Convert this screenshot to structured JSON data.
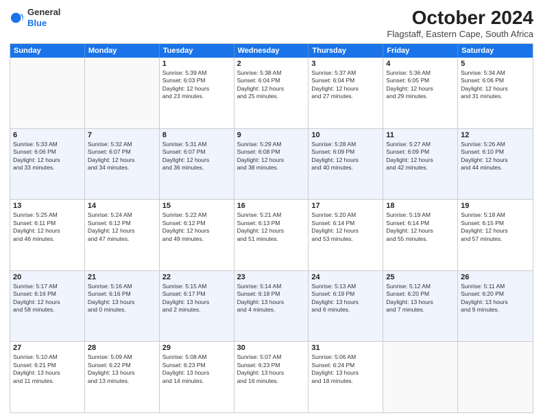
{
  "logo": {
    "line1": "General",
    "line2": "Blue"
  },
  "title": "October 2024",
  "subtitle": "Flagstaff, Eastern Cape, South Africa",
  "days": [
    "Sunday",
    "Monday",
    "Tuesday",
    "Wednesday",
    "Thursday",
    "Friday",
    "Saturday"
  ],
  "weeks": [
    [
      {
        "day": "",
        "content": ""
      },
      {
        "day": "",
        "content": ""
      },
      {
        "day": "1",
        "content": "Sunrise: 5:39 AM\nSunset: 6:03 PM\nDaylight: 12 hours\nand 23 minutes."
      },
      {
        "day": "2",
        "content": "Sunrise: 5:38 AM\nSunset: 6:04 PM\nDaylight: 12 hours\nand 25 minutes."
      },
      {
        "day": "3",
        "content": "Sunrise: 5:37 AM\nSunset: 6:04 PM\nDaylight: 12 hours\nand 27 minutes."
      },
      {
        "day": "4",
        "content": "Sunrise: 5:36 AM\nSunset: 6:05 PM\nDaylight: 12 hours\nand 29 minutes."
      },
      {
        "day": "5",
        "content": "Sunrise: 5:34 AM\nSunset: 6:06 PM\nDaylight: 12 hours\nand 31 minutes."
      }
    ],
    [
      {
        "day": "6",
        "content": "Sunrise: 5:33 AM\nSunset: 6:06 PM\nDaylight: 12 hours\nand 33 minutes."
      },
      {
        "day": "7",
        "content": "Sunrise: 5:32 AM\nSunset: 6:07 PM\nDaylight: 12 hours\nand 34 minutes."
      },
      {
        "day": "8",
        "content": "Sunrise: 5:31 AM\nSunset: 6:07 PM\nDaylight: 12 hours\nand 36 minutes."
      },
      {
        "day": "9",
        "content": "Sunrise: 5:29 AM\nSunset: 6:08 PM\nDaylight: 12 hours\nand 38 minutes."
      },
      {
        "day": "10",
        "content": "Sunrise: 5:28 AM\nSunset: 6:09 PM\nDaylight: 12 hours\nand 40 minutes."
      },
      {
        "day": "11",
        "content": "Sunrise: 5:27 AM\nSunset: 6:09 PM\nDaylight: 12 hours\nand 42 minutes."
      },
      {
        "day": "12",
        "content": "Sunrise: 5:26 AM\nSunset: 6:10 PM\nDaylight: 12 hours\nand 44 minutes."
      }
    ],
    [
      {
        "day": "13",
        "content": "Sunrise: 5:25 AM\nSunset: 6:11 PM\nDaylight: 12 hours\nand 46 minutes."
      },
      {
        "day": "14",
        "content": "Sunrise: 5:24 AM\nSunset: 6:12 PM\nDaylight: 12 hours\nand 47 minutes."
      },
      {
        "day": "15",
        "content": "Sunrise: 5:22 AM\nSunset: 6:12 PM\nDaylight: 12 hours\nand 49 minutes."
      },
      {
        "day": "16",
        "content": "Sunrise: 5:21 AM\nSunset: 6:13 PM\nDaylight: 12 hours\nand 51 minutes."
      },
      {
        "day": "17",
        "content": "Sunrise: 5:20 AM\nSunset: 6:14 PM\nDaylight: 12 hours\nand 53 minutes."
      },
      {
        "day": "18",
        "content": "Sunrise: 5:19 AM\nSunset: 6:14 PM\nDaylight: 12 hours\nand 55 minutes."
      },
      {
        "day": "19",
        "content": "Sunrise: 5:18 AM\nSunset: 6:15 PM\nDaylight: 12 hours\nand 57 minutes."
      }
    ],
    [
      {
        "day": "20",
        "content": "Sunrise: 5:17 AM\nSunset: 6:16 PM\nDaylight: 12 hours\nand 58 minutes."
      },
      {
        "day": "21",
        "content": "Sunrise: 5:16 AM\nSunset: 6:16 PM\nDaylight: 13 hours\nand 0 minutes."
      },
      {
        "day": "22",
        "content": "Sunrise: 5:15 AM\nSunset: 6:17 PM\nDaylight: 13 hours\nand 2 minutes."
      },
      {
        "day": "23",
        "content": "Sunrise: 5:14 AM\nSunset: 6:18 PM\nDaylight: 13 hours\nand 4 minutes."
      },
      {
        "day": "24",
        "content": "Sunrise: 5:13 AM\nSunset: 6:19 PM\nDaylight: 13 hours\nand 6 minutes."
      },
      {
        "day": "25",
        "content": "Sunrise: 5:12 AM\nSunset: 6:20 PM\nDaylight: 13 hours\nand 7 minutes."
      },
      {
        "day": "26",
        "content": "Sunrise: 5:11 AM\nSunset: 6:20 PM\nDaylight: 13 hours\nand 9 minutes."
      }
    ],
    [
      {
        "day": "27",
        "content": "Sunrise: 5:10 AM\nSunset: 6:21 PM\nDaylight: 13 hours\nand 11 minutes."
      },
      {
        "day": "28",
        "content": "Sunrise: 5:09 AM\nSunset: 6:22 PM\nDaylight: 13 hours\nand 13 minutes."
      },
      {
        "day": "29",
        "content": "Sunrise: 5:08 AM\nSunset: 6:23 PM\nDaylight: 13 hours\nand 14 minutes."
      },
      {
        "day": "30",
        "content": "Sunrise: 5:07 AM\nSunset: 6:23 PM\nDaylight: 13 hours\nand 16 minutes."
      },
      {
        "day": "31",
        "content": "Sunrise: 5:06 AM\nSunset: 6:24 PM\nDaylight: 13 hours\nand 18 minutes."
      },
      {
        "day": "",
        "content": ""
      },
      {
        "day": "",
        "content": ""
      }
    ]
  ]
}
